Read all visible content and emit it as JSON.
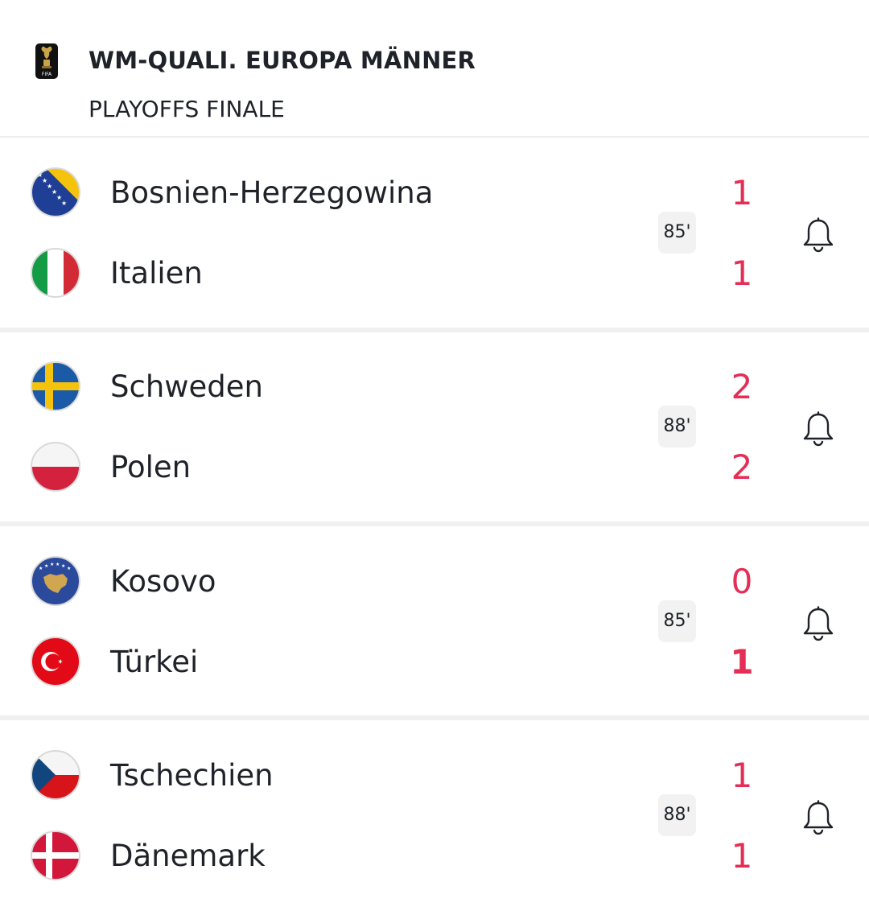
{
  "competition": {
    "title": "WM-QUALI. EUROPA MÄNNER",
    "round": "PLAYOFFS FINALE",
    "logo_icon": "world-cup-trophy-icon",
    "logo_text": "FIFA"
  },
  "colors": {
    "score": "#e52d55",
    "text": "#1f2329",
    "minute_bg": "#f2f2f2",
    "separator": "#f0f0f0"
  },
  "matches": [
    {
      "minute": "85'",
      "home": {
        "name": "Bosnien-Herzegowina",
        "score": "1",
        "flag_icon": "flag-bosnia-icon"
      },
      "away": {
        "name": "Italien",
        "score": "1",
        "flag_icon": "flag-italy-icon"
      },
      "bell_icon": "bell-icon"
    },
    {
      "minute": "88'",
      "home": {
        "name": "Schweden",
        "score": "2",
        "flag_icon": "flag-sweden-icon"
      },
      "away": {
        "name": "Polen",
        "score": "2",
        "flag_icon": "flag-poland-icon"
      },
      "bell_icon": "bell-icon"
    },
    {
      "minute": "85'",
      "home": {
        "name": "Kosovo",
        "score": "0",
        "flag_icon": "flag-kosovo-icon"
      },
      "away": {
        "name": "Türkei",
        "score": "1",
        "flag_icon": "flag-turkey-icon"
      },
      "bell_icon": "bell-icon"
    },
    {
      "minute": "88'",
      "home": {
        "name": "Tschechien",
        "score": "1",
        "flag_icon": "flag-czechia-icon"
      },
      "away": {
        "name": "Dänemark",
        "score": "1",
        "flag_icon": "flag-denmark-icon"
      },
      "bell_icon": "bell-icon"
    }
  ]
}
